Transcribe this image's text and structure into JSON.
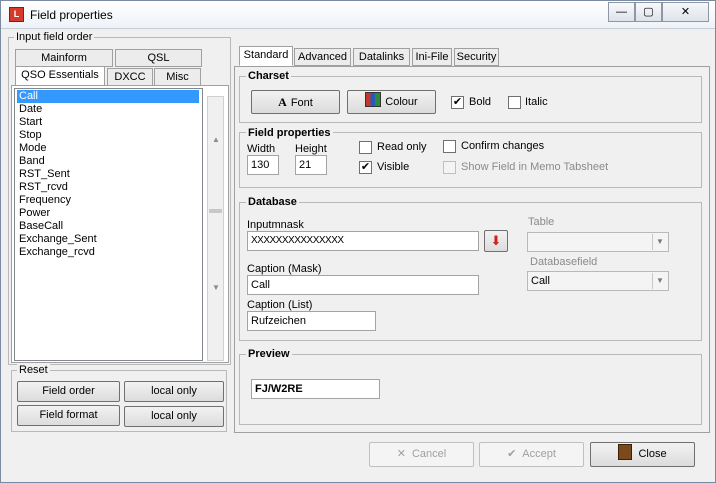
{
  "window": {
    "title": "Field properties",
    "icon": "app-icon",
    "controls": {
      "minimize": "—",
      "maximize": "▢",
      "close": "✕"
    }
  },
  "left": {
    "input_field_order_label": "Input field order",
    "tabs_row1": [
      "Mainform",
      "QSL"
    ],
    "tabs_row2": [
      "QSO Essentials",
      "DXCC",
      "Misc"
    ],
    "fields": [
      "Call",
      "Date",
      "Start",
      "Stop",
      "Mode",
      "Band",
      "RST_Sent",
      "RST_rcvd",
      "Frequency",
      "Power",
      "BaseCall",
      "Exchange_Sent",
      "Exchange_rcvd"
    ],
    "selected_field": "Call",
    "reset": {
      "label": "Reset",
      "field_order": "Field order",
      "local_only_1": "local only",
      "field_format": "Field format",
      "local_only_2": "local only"
    }
  },
  "right": {
    "tabs": [
      "Standard",
      "Advanced",
      "Datalinks",
      "Ini-File",
      "Security"
    ],
    "active_tab": "Standard",
    "charset": {
      "label": "Charset",
      "font_button": "Font",
      "colour_button": "Colour",
      "bold_label": "Bold",
      "bold_checked": true,
      "italic_label": "Italic",
      "italic_checked": false
    },
    "field_properties": {
      "label": "Field properties",
      "width_label": "Width",
      "width_value": "130",
      "height_label": "Height",
      "height_value": "21",
      "read_only_label": "Read only",
      "read_only_checked": false,
      "visible_label": "Visible",
      "visible_checked": true,
      "confirm_label": "Confirm changes",
      "confirm_checked": false,
      "memo_label": "Show Field in Memo Tabsheet",
      "memo_checked": false
    },
    "database": {
      "label": "Database",
      "inputmask_label": "Inputmnask",
      "inputmask_value": "XXXXXXXXXXXXXXX",
      "table_label": "Table",
      "table_value": "",
      "caption_mask_label": "Caption (Mask)",
      "caption_mask_value": "Call",
      "databasefield_label": "Databasefield",
      "databasefield_value": "Call",
      "caption_list_label": "Caption (List)",
      "caption_list_value": "Rufzeichen"
    },
    "preview": {
      "label": "Preview",
      "value": "FJ/W2RE"
    }
  },
  "footer": {
    "cancel": "Cancel",
    "accept": "Accept",
    "close": "Close"
  },
  "colors": {
    "selection": "#3399ff",
    "dropdown_arrow": "#d0201a"
  }
}
